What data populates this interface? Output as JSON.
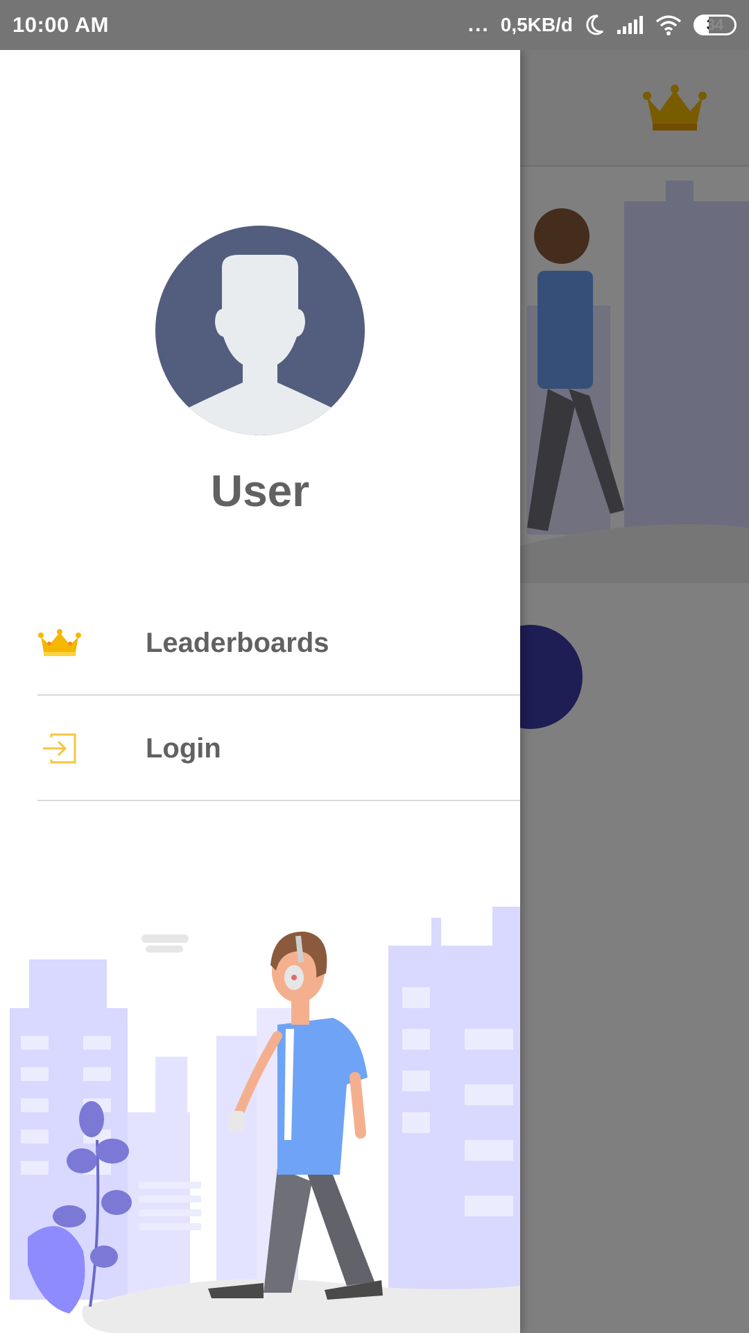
{
  "status_bar": {
    "time": "10:00 AM",
    "dots": "...",
    "network_speed": "0,5KB/d",
    "battery_level": "34",
    "icons": [
      "moon-icon",
      "signal-icon",
      "wifi-icon",
      "battery-icon"
    ]
  },
  "drawer": {
    "user_name": "User",
    "menu": [
      {
        "label": "Leaderboards",
        "icon": "crown-icon"
      },
      {
        "label": "Login",
        "icon": "login-icon"
      }
    ]
  },
  "colors": {
    "accent": "#f5b800",
    "avatar_bg": "#535d7e",
    "fab": "#3c3aa8",
    "illustration_purple": "#d9d8ff"
  }
}
